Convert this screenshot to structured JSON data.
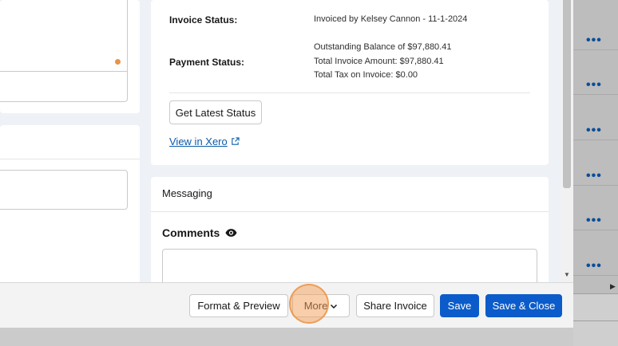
{
  "invoice": {
    "status_label": "Invoice Status:",
    "status_value": "Invoiced by Kelsey Cannon - 11-1-2024",
    "payment_label": "Payment Status:",
    "payment_lines": [
      "Outstanding Balance of $97,880.41",
      "Total Invoice Amount: $97,880.41",
      "Total Tax on Invoice: $0.00"
    ],
    "get_status_label": "Get Latest Status",
    "view_link_label": "View in Xero"
  },
  "messaging": {
    "title": "Messaging",
    "comments_label": "Comments"
  },
  "footer": {
    "format_preview_label": "Format & Preview",
    "more_label": "More",
    "share_label": "Share Invoice",
    "save_label": "Save",
    "save_close_label": "Save & Close"
  },
  "background_list": {
    "row_action_icon": "more-horizontal-icon"
  },
  "colors": {
    "brand": "#0b5cca",
    "link": "#0b5cab",
    "highlight": "#f4a057"
  }
}
